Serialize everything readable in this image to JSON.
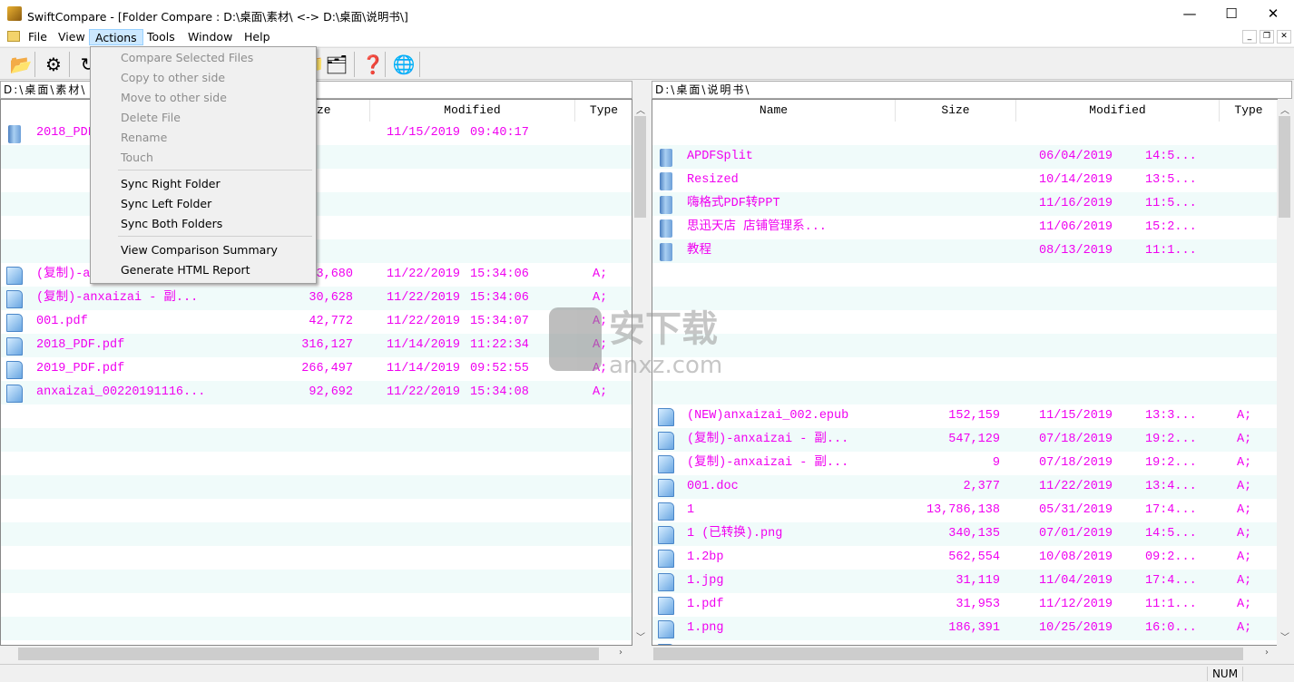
{
  "title": "SwiftCompare - [Folder Compare :  D:\\桌面\\素材\\   <->   D:\\桌面\\说明书\\]",
  "window_controls": {
    "minimize": "—",
    "maximize": "☐",
    "close": "✕"
  },
  "menu": [
    "File",
    "View",
    "Actions",
    "Tools",
    "Window",
    "Help"
  ],
  "mdi_controls": [
    "_",
    "❐",
    "✕"
  ],
  "toolbar": [
    {
      "icon": "open-folder-icon",
      "glyph": "📂"
    },
    {
      "icon": "settings-icon",
      "glyph": "⚙"
    },
    {
      "icon": "refresh-icon",
      "glyph": "↻"
    },
    {
      "icon": "copy-icon",
      "glyph": "📁"
    },
    {
      "icon": "sync-folder-icon",
      "glyph": "🗂"
    },
    {
      "icon": "help-book-icon",
      "glyph": "❓"
    },
    {
      "icon": "html-report-icon",
      "glyph": "🌐"
    }
  ],
  "actions_menu": {
    "items": [
      {
        "label": "Compare Selected Files",
        "disabled": true
      },
      {
        "label": "Copy to other side",
        "disabled": true
      },
      {
        "label": "Move to other side",
        "disabled": true
      },
      {
        "label": "Delete File",
        "disabled": true
      },
      {
        "label": "Rename",
        "disabled": true
      },
      {
        "label": "Touch",
        "disabled": true
      },
      {
        "label": "Sync Right Folder",
        "disabled": false
      },
      {
        "label": "Sync Left Folder",
        "disabled": false
      },
      {
        "label": "Sync Both Folders",
        "disabled": false
      },
      {
        "label": "View Comparison Summary",
        "disabled": false
      },
      {
        "label": "Generate HTML Report",
        "disabled": false
      }
    ]
  },
  "columns": [
    "Name",
    "Size",
    "Modified",
    "Type"
  ],
  "left": {
    "path": "D:\\桌面\\素材\\",
    "rows": [
      {
        "type": "folder",
        "name": "2018_PDF",
        "size": "",
        "date": "11/15/2019",
        "time": "09:40:17",
        "attr": ""
      },
      null,
      null,
      null,
      null,
      null,
      {
        "type": "file",
        "name": "(复制)-anxaizai - 副...",
        "size": "33,680",
        "date": "11/22/2019",
        "time": "15:34:06",
        "attr": "A;"
      },
      {
        "type": "file",
        "name": "(复制)-anxaizai - 副...",
        "size": "30,628",
        "date": "11/22/2019",
        "time": "15:34:06",
        "attr": "A;"
      },
      {
        "type": "file",
        "name": "001.pdf",
        "size": "42,772",
        "date": "11/22/2019",
        "time": "15:34:07",
        "attr": "A;"
      },
      {
        "type": "file",
        "name": "2018_PDF.pdf",
        "size": "316,127",
        "date": "11/14/2019",
        "time": "11:22:34",
        "attr": "A;"
      },
      {
        "type": "file",
        "name": "2019_PDF.pdf",
        "size": "266,497",
        "date": "11/14/2019",
        "time": "09:52:55",
        "attr": "A;"
      },
      {
        "type": "file",
        "name": "anxaizai_00220191116...",
        "size": "92,692",
        "date": "11/22/2019",
        "time": "15:34:08",
        "attr": "A;"
      },
      null,
      null,
      null,
      null,
      null,
      null,
      null,
      null,
      null,
      null,
      null
    ]
  },
  "right": {
    "path": "D:\\桌面\\说明书\\",
    "rows": [
      null,
      {
        "type": "folder",
        "name": "APDFSplit",
        "size": "",
        "date": "06/04/2019",
        "time": "14:5...",
        "attr": ""
      },
      {
        "type": "folder",
        "name": "Resized",
        "size": "",
        "date": "10/14/2019",
        "time": "13:5...",
        "attr": ""
      },
      {
        "type": "folder",
        "name": "嗨格式PDF转PPT",
        "size": "",
        "date": "11/16/2019",
        "time": "11:5...",
        "attr": ""
      },
      {
        "type": "folder",
        "name": "思迅天店 店铺管理系...",
        "size": "",
        "date": "11/06/2019",
        "time": "15:2...",
        "attr": ""
      },
      {
        "type": "folder",
        "name": "教程",
        "size": "",
        "date": "08/13/2019",
        "time": "11:1...",
        "attr": ""
      },
      null,
      null,
      null,
      null,
      null,
      null,
      {
        "type": "file",
        "name": "(NEW)anxaizai_002.epub",
        "size": "152,159",
        "date": "11/15/2019",
        "time": "13:3...",
        "attr": "A;"
      },
      {
        "type": "file",
        "name": "(复制)-anxaizai - 副...",
        "size": "547,129",
        "date": "07/18/2019",
        "time": "19:2...",
        "attr": "A;"
      },
      {
        "type": "file",
        "name": "(复制)-anxaizai - 副...",
        "size": "9",
        "date": "07/18/2019",
        "time": "19:2...",
        "attr": "A;"
      },
      {
        "type": "file",
        "name": "001.doc",
        "size": "2,377",
        "date": "11/22/2019",
        "time": "13:4...",
        "attr": "A;"
      },
      {
        "type": "file",
        "name": "1",
        "size": "13,786,138",
        "date": "05/31/2019",
        "time": "17:4...",
        "attr": "A;"
      },
      {
        "type": "file",
        "name": "1 (已转换).png",
        "size": "340,135",
        "date": "07/01/2019",
        "time": "14:5...",
        "attr": "A;"
      },
      {
        "type": "file",
        "name": "1.2bp",
        "size": "562,554",
        "date": "10/08/2019",
        "time": "09:2...",
        "attr": "A;"
      },
      {
        "type": "file",
        "name": "1.jpg",
        "size": "31,119",
        "date": "11/04/2019",
        "time": "17:4...",
        "attr": "A;"
      },
      {
        "type": "file",
        "name": "1.pdf",
        "size": "31,953",
        "date": "11/12/2019",
        "time": "11:1...",
        "attr": "A;"
      },
      {
        "type": "file",
        "name": "1.png",
        "size": "186,391",
        "date": "10/25/2019",
        "time": "16:0...",
        "attr": "A;"
      },
      {
        "type": "file",
        "name": "",
        "size": "",
        "date": "",
        "time": "",
        "attr": ""
      }
    ]
  },
  "watermark": {
    "text": "安下载",
    "subtext": "anxz.com"
  },
  "status": {
    "num": "NUM"
  },
  "colors": {
    "text": "#f000f0",
    "stripe": "#f0fbfa",
    "menu_active": "#cce8ff"
  }
}
